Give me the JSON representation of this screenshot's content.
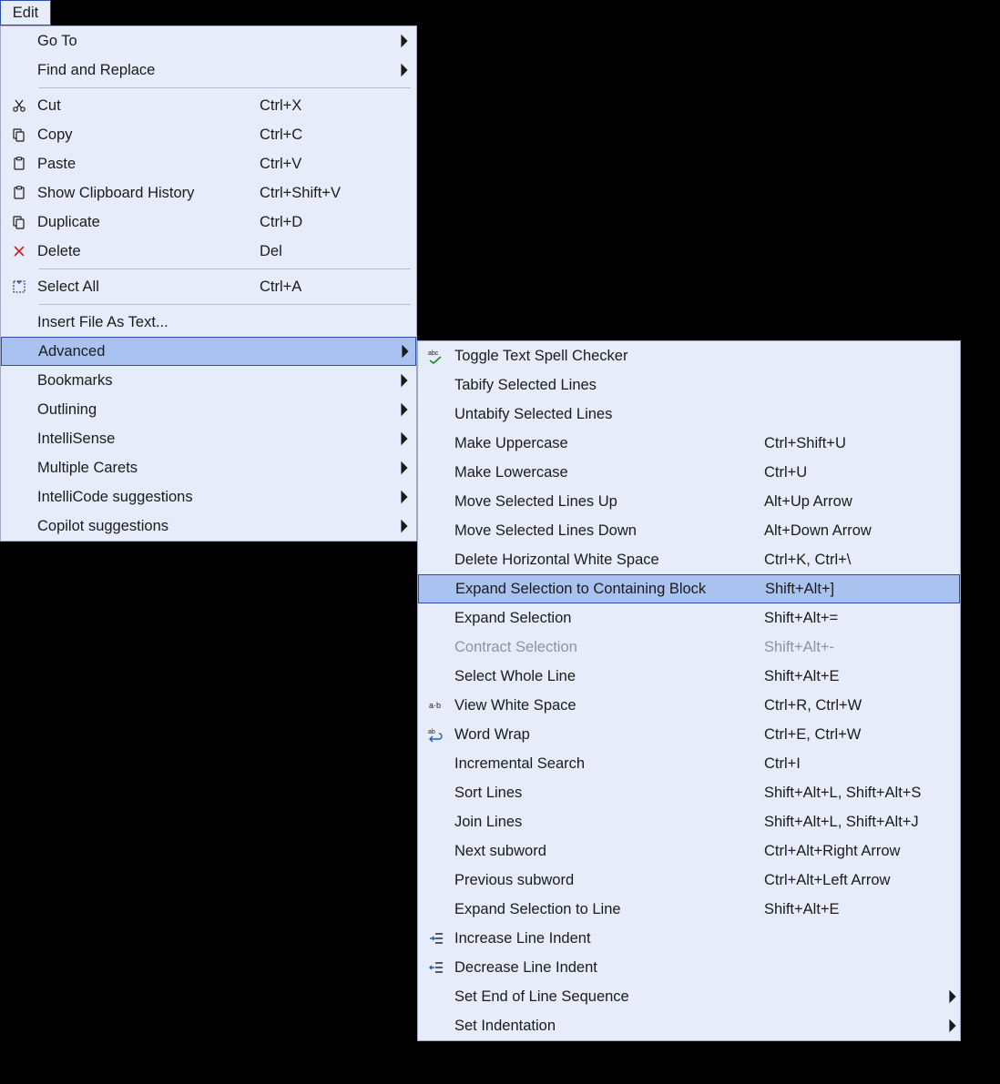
{
  "menubar": {
    "edit": "Edit"
  },
  "edit_menu": {
    "goto": "Go To",
    "find": "Find and Replace",
    "cut": "Cut",
    "cut_sc": "Ctrl+X",
    "copy": "Copy",
    "copy_sc": "Ctrl+C",
    "paste": "Paste",
    "paste_sc": "Ctrl+V",
    "show_clip": "Show Clipboard History",
    "show_clip_sc": "Ctrl+Shift+V",
    "duplicate": "Duplicate",
    "duplicate_sc": "Ctrl+D",
    "delete": "Delete",
    "delete_sc": "Del",
    "select_all": "Select All",
    "select_all_sc": "Ctrl+A",
    "insert_file": "Insert File As Text...",
    "advanced": "Advanced",
    "bookmarks": "Bookmarks",
    "outlining": "Outlining",
    "intellisense": "IntelliSense",
    "multiple_carets": "Multiple Carets",
    "intellicode": "IntelliCode suggestions",
    "copilot": "Copilot suggestions"
  },
  "advanced_menu": {
    "spell": "Toggle Text Spell Checker",
    "tabify": "Tabify Selected Lines",
    "untabify": "Untabify Selected Lines",
    "uppercase": "Make Uppercase",
    "uppercase_sc": "Ctrl+Shift+U",
    "lowercase": "Make Lowercase",
    "lowercase_sc": "Ctrl+U",
    "move_up": "Move Selected Lines Up",
    "move_up_sc": "Alt+Up Arrow",
    "move_down": "Move Selected Lines Down",
    "move_down_sc": "Alt+Down Arrow",
    "del_hspace": "Delete Horizontal White Space",
    "del_hspace_sc": "Ctrl+K, Ctrl+\\",
    "expand_block": "Expand Selection to Containing Block",
    "expand_block_sc": "Shift+Alt+]",
    "expand_sel": "Expand Selection",
    "expand_sel_sc": "Shift+Alt+=",
    "contract_sel": "Contract Selection",
    "contract_sel_sc": "Shift+Alt+-",
    "select_line": "Select Whole Line",
    "select_line_sc": "Shift+Alt+E",
    "view_ws": "View White Space",
    "view_ws_sc": "Ctrl+R, Ctrl+W",
    "word_wrap": "Word Wrap",
    "word_wrap_sc": "Ctrl+E, Ctrl+W",
    "inc_search": "Incremental Search",
    "inc_search_sc": "Ctrl+I",
    "sort_lines": "Sort Lines",
    "sort_lines_sc": "Shift+Alt+L, Shift+Alt+S",
    "join_lines": "Join Lines",
    "join_lines_sc": "Shift+Alt+L, Shift+Alt+J",
    "next_subword": "Next subword",
    "next_subword_sc": "Ctrl+Alt+Right Arrow",
    "prev_subword": "Previous subword",
    "prev_subword_sc": "Ctrl+Alt+Left Arrow",
    "expand_line": "Expand Selection to Line",
    "expand_line_sc": "Shift+Alt+E",
    "inc_indent": "Increase Line Indent",
    "dec_indent": "Decrease Line Indent",
    "eol_seq": "Set End of Line Sequence",
    "set_indent": "Set Indentation"
  }
}
